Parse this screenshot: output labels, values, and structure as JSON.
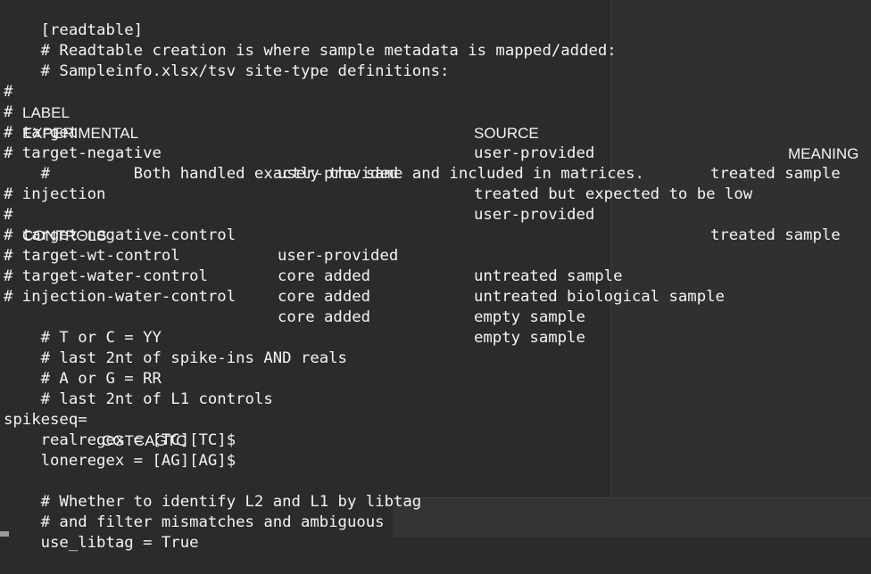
{
  "terminal": {
    "lines": [
      {
        "text": "[readtable]"
      },
      {
        "text": "# Readtable creation is where sample metadata is mapped/added:"
      },
      {
        "text": "# Sampleinfo.xlsx/tsv site-type definitions:"
      },
      {
        "prefix": "# ",
        "label": "LABEL",
        "source": "SOURCE",
        "meaning": "MEANING"
      },
      {
        "prefix": "# ",
        "label": "EXPERIMENTAL"
      },
      {
        "text": "# target",
        "source": "user-provided",
        "meaning": "treated sample"
      },
      {
        "text": "# target-negative",
        "source": "user-provided",
        "meaning": "treated but expected to be low"
      },
      {
        "text": "#         Both handled exactly the same and included in matrices."
      },
      {
        "text": "# injection",
        "source": "user-provided",
        "meaning": "treated sample"
      },
      {
        "prefix": "# ",
        "label": "CONTROLS"
      },
      {
        "text": "# target-negative-control",
        "source": "user-provided",
        "meaning": "untreated sample"
      },
      {
        "text": "# target-wt-control",
        "source": "core added",
        "meaning": "untreated biological sample"
      },
      {
        "text": "# target-water-control",
        "source": "core added",
        "meaning": "empty sample"
      },
      {
        "text": "# injection-water-control",
        "source": "core added",
        "meaning": "empty sample"
      },
      {
        "text": ""
      },
      {
        "text": "# T or C = YY"
      },
      {
        "text": "# last 2nt of spike-ins AND reals"
      },
      {
        "text": "# A or G = RR"
      },
      {
        "text": "# last 2nt of L1 controls"
      },
      {
        "prefix": "spikeseq= ",
        "label": "CGTCAGTC"
      },
      {
        "text": "realregex = [TC][TC]$"
      },
      {
        "text": "loneregex = [AG][AG]$"
      },
      {
        "text": ""
      },
      {
        "text": "# Whether to identify L2 and L1 by libtag"
      },
      {
        "text": "# and filter mismatches and ambiguous"
      },
      {
        "text": "use_libtag = True"
      }
    ]
  }
}
